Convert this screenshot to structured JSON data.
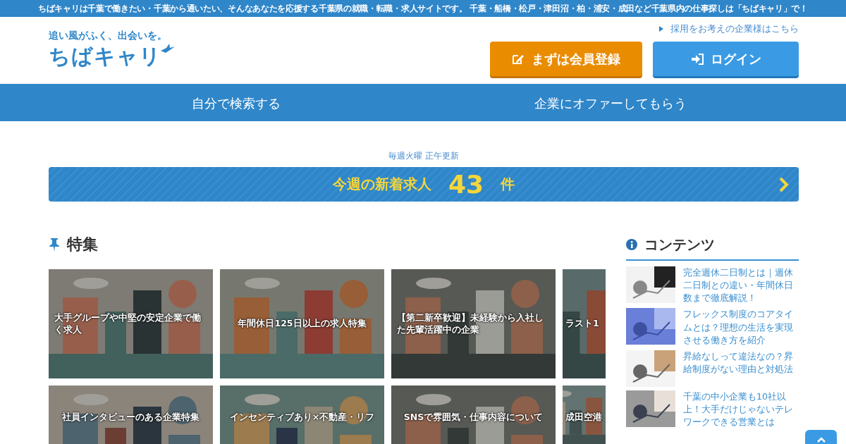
{
  "top_banner": "ちばキャリは千葉で働きたい・千葉から通いたい、そんなあなたを応援する千葉県の就職・転職・求人サイトです。 千葉・船橋・松戸・津田沼・柏・浦安・成田など千葉県内の仕事探しは「ちばキャリ」で！",
  "header": {
    "tagline": "追い風がふく、出会いを。",
    "logo": "ちばキャリ",
    "company_link": "採用をお考えの企業様はこちら",
    "buttons": [
      {
        "kind": "register",
        "label": "まずは会員登録"
      },
      {
        "kind": "login",
        "label": "ログイン"
      }
    ]
  },
  "nav": [
    "自分で検索する",
    "企業にオファーしてもらう"
  ],
  "update_note": "毎週火曜 正午更新",
  "new_jobs": {
    "label": "今週の新着求人",
    "count": "43",
    "unit": "件"
  },
  "features": {
    "title": "特集",
    "cards": [
      {
        "title": "大手グループや中堅の安定企業で働く求人",
        "kind": "picture"
      },
      {
        "title": "年間休日125日以上の求人特集",
        "kind": "picture"
      },
      {
        "title": "【第二新卒歓迎】未経験から入社した先輩活躍中の企業",
        "kind": "picture"
      },
      {
        "title": "ラスト1",
        "kind": "picture"
      },
      {
        "title": "社員インタビューのある企業特集",
        "kind": "picture"
      },
      {
        "title": "インセンティブあり×不動産・リフ",
        "kind": "picture"
      },
      {
        "title": "SNSで雰囲気・仕事内容について",
        "kind": "picture"
      },
      {
        "title": "成田空港",
        "kind": "picture"
      }
    ]
  },
  "contents": {
    "title": "コンテンツ",
    "items": [
      {
        "title": "完全週休二日制とは｜週休二日制との違い・年間休日数まで徹底解説！",
        "kind": "picture"
      },
      {
        "title": "フレックス制度のコアタイムとは？理想の生活を実現させる働き方を紹介",
        "kind": "picture"
      },
      {
        "title": "昇給なしって違法なの？昇給制度がない理由と対処法",
        "kind": "picture"
      },
      {
        "title": "千葉の中小企業も10社以上！大手だけじゃないテレワークできる営業とは",
        "kind": "picture"
      }
    ]
  }
}
